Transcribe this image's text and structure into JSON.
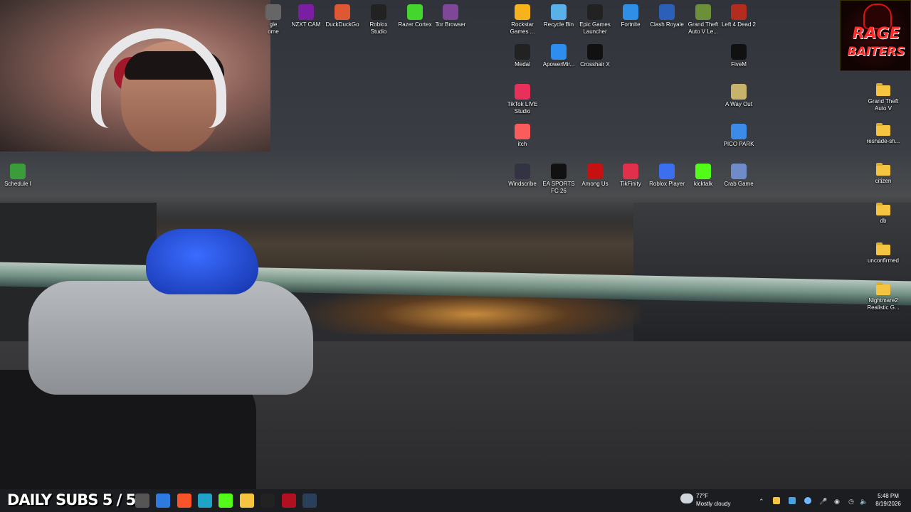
{
  "stream_overlay": {
    "daily_subs": "DAILY SUBS 5 / 5",
    "brand_line1": "RAGE",
    "brand_line2": "BAITERS"
  },
  "desktop_icons_left": [
    {
      "label": "gle\nome",
      "icon": "chrome-icon"
    },
    {
      "label": "NZXT CAM",
      "icon": "nzxt-cam-icon",
      "color": "#7b1fa2"
    },
    {
      "label": "DuckDuckGo",
      "icon": "duckduckgo-icon",
      "color": "#de5833"
    },
    {
      "label": "Roblox\nStudio",
      "icon": "roblox-studio-icon",
      "color": "#222"
    },
    {
      "label": "Razer Cortex",
      "icon": "razer-cortex-icon",
      "color": "#44d62c"
    },
    {
      "label": "Tor Browser",
      "icon": "tor-browser-icon",
      "color": "#7e4798"
    },
    {
      "label": "Schedule I",
      "icon": "schedule-one-icon",
      "color": "#3a9c3a"
    }
  ],
  "desktop_icons": [
    {
      "label": "Rockstar\nGames ...",
      "icon": "rockstar-icon",
      "color": "#f7b31b"
    },
    {
      "label": "Recycle Bin",
      "icon": "recycle-bin-icon",
      "color": "#5ab0e8"
    },
    {
      "label": "Epic Games\nLauncher",
      "icon": "epic-games-icon",
      "color": "#222"
    },
    {
      "label": "Fortnite",
      "icon": "fortnite-icon",
      "color": "#2f8fe6"
    },
    {
      "label": "Clash Royale",
      "icon": "clash-royale-icon",
      "color": "#2b5fb8"
    },
    {
      "label": "Grand Theft\nAuto V Le...",
      "icon": "gta-v-icon",
      "color": "#6c8f3a"
    },
    {
      "label": "Left 4 Dead 2",
      "icon": "left4dead2-icon",
      "color": "#b32d1e"
    },
    {
      "label": "Medal",
      "icon": "medal-icon",
      "color": "#222"
    },
    {
      "label": "ApowerMir...",
      "icon": "apowermirror-icon",
      "color": "#2d8ef0"
    },
    {
      "label": "Crosshair X",
      "icon": "crosshair-x-icon",
      "color": "#111"
    },
    {
      "label": "FiveM",
      "icon": "fivem-icon",
      "color": "#111"
    },
    {
      "label": "TikTok LIVE\nStudio",
      "icon": "tiktok-live-studio-icon",
      "color": "#e8305a"
    },
    {
      "label": "A Way Out",
      "icon": "a-way-out-icon",
      "color": "#c7b46a"
    },
    {
      "label": "itch",
      "icon": "itch-icon",
      "color": "#fa5c5c"
    },
    {
      "label": "PICO PARK",
      "icon": "pico-park-icon",
      "color": "#3d8be8"
    },
    {
      "label": "Windscribe",
      "icon": "windscribe-icon",
      "color": "#334"
    },
    {
      "label": "EA SPORTS\nFC 26",
      "icon": "ea-sports-fc-icon",
      "color": "#111"
    },
    {
      "label": "Among Us",
      "icon": "among-us-icon",
      "color": "#c51111"
    },
    {
      "label": "TikFinity",
      "icon": "tikfinity-icon",
      "color": "#e0304a"
    },
    {
      "label": "Roblox Player",
      "icon": "roblox-player-icon",
      "color": "#3b6ff0"
    },
    {
      "label": "kicktalk",
      "icon": "kicktalk-icon",
      "color": "#53fc18"
    },
    {
      "label": "Crab Game",
      "icon": "crab-game-icon",
      "color": "#6f8cc9"
    }
  ],
  "desktop_folders": [
    {
      "label": "Grand Theft\nAuto V"
    },
    {
      "label": "reshade-sh..."
    },
    {
      "label": "citizen"
    },
    {
      "label": "db"
    },
    {
      "label": "unconfirmed"
    },
    {
      "label": "Nightmare2\nRealistic G..."
    }
  ],
  "taskbar": {
    "weather_temp": "77°F",
    "weather_desc": "Mostly cloudy",
    "time": "5:48 PM",
    "date": "8/19/2026",
    "apps": [
      {
        "icon": "task-view-icon",
        "color": "#555"
      },
      {
        "icon": "app-icon",
        "color": "#2d7be0"
      },
      {
        "icon": "brave-icon",
        "color": "#fb542b"
      },
      {
        "icon": "edge-icon",
        "color": "#1fa3c9"
      },
      {
        "icon": "kick-icon",
        "color": "#53fc18"
      },
      {
        "icon": "file-explorer-icon",
        "color": "#f5c542"
      },
      {
        "icon": "fivem-taskbar-icon",
        "color": "#222"
      },
      {
        "icon": "app-red-icon",
        "color": "#b01020"
      },
      {
        "icon": "steam-icon",
        "color": "#2a3f5a"
      }
    ]
  }
}
